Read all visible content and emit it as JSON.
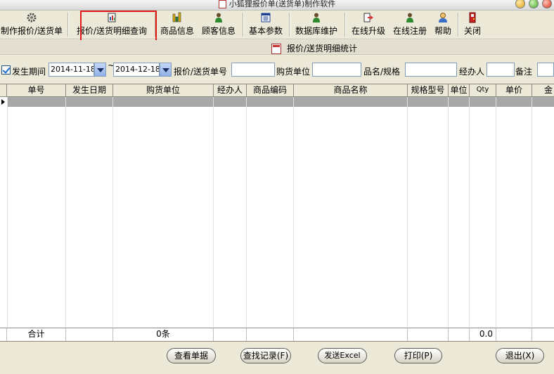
{
  "window": {
    "title": "小狐狸报价单(送货单)制作软件"
  },
  "toolbar": {
    "items": [
      {
        "label": "制作报价/送货单"
      },
      {
        "label": "报价/送货明细查询"
      },
      {
        "label": "商品信息"
      },
      {
        "label": "顾客信息"
      },
      {
        "label": "基本参数"
      },
      {
        "label": "数据库维护"
      },
      {
        "label": "在线升级"
      },
      {
        "label": "在线注册"
      },
      {
        "label": "帮助"
      },
      {
        "label": "关闭"
      }
    ]
  },
  "panel": {
    "title": "报价/送货明细统计"
  },
  "filter": {
    "period_label": "发生期间",
    "period_checked": true,
    "date_from": "2014-11-18",
    "tilde": "~",
    "date_to": "2014-12-18",
    "order_no_label": "报价/送货单号",
    "order_no_value": "",
    "buyer_label": "购货单位",
    "buyer_value": "",
    "product_label": "品名/规格",
    "product_value": "",
    "handler_label": "经办人",
    "handler_value": "",
    "remark_label": "备注",
    "remark_value": ""
  },
  "table": {
    "columns": [
      "单号",
      "发生日期",
      "购货单位",
      "经办人",
      "商品编码",
      "商品名称",
      "规格型号",
      "单位",
      "Qty",
      "单价",
      "金"
    ],
    "rows": [],
    "footer": {
      "label": "合计",
      "count": "0条",
      "qty_total": "0.0"
    }
  },
  "buttons": {
    "view": "查看单据",
    "find": "查找记录(F)",
    "send_excel": "发送Excel",
    "print": "打印(P)",
    "exit": "退出(X)"
  },
  "colors": {
    "highlight": "#e01818",
    "selected_row": "#a8a8a8",
    "background": "#ece9d8"
  }
}
